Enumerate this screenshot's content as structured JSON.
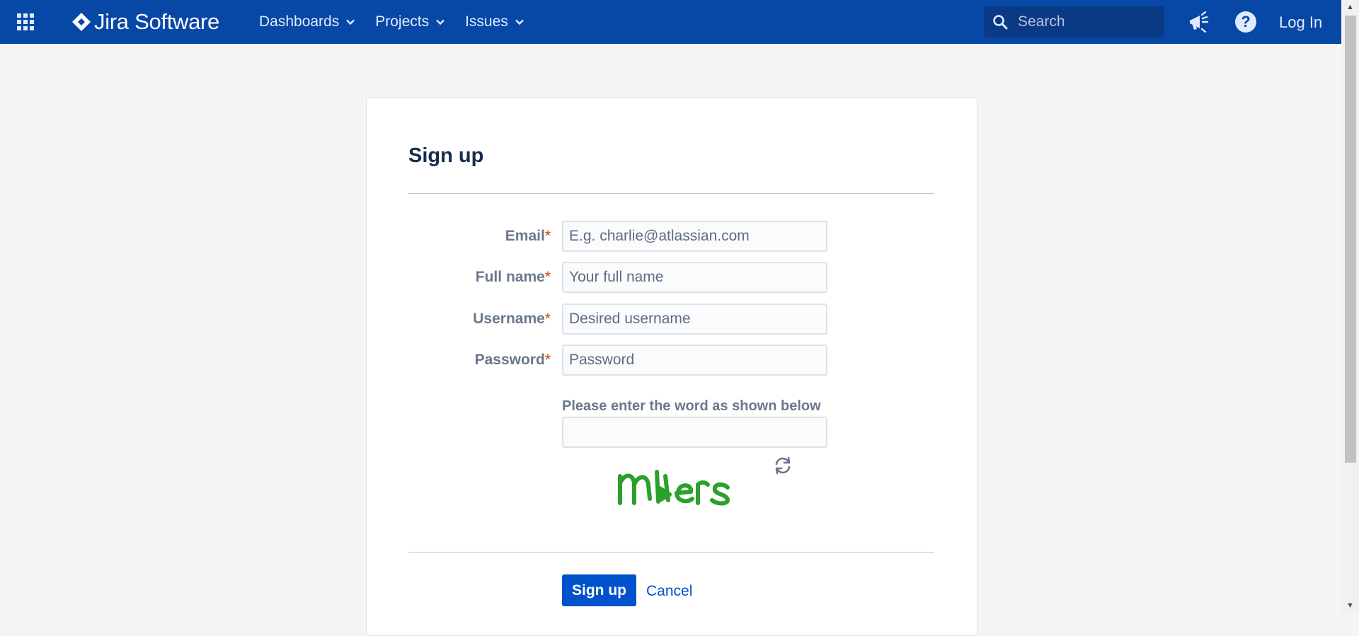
{
  "header": {
    "app_switcher_icon": "app-switcher-icon",
    "logo_text": "Jira Software",
    "nav": [
      {
        "label": "Dashboards"
      },
      {
        "label": "Projects"
      },
      {
        "label": "Issues"
      }
    ],
    "search_placeholder": "Search",
    "login_label": "Log In",
    "colors": {
      "bar": "#0747a6",
      "text": "#deebff"
    }
  },
  "signup": {
    "title": "Sign up",
    "fields": [
      {
        "label": "Email",
        "required_mark": "*",
        "placeholder": "E.g. charlie@atlassian.com"
      },
      {
        "label": "Full name",
        "required_mark": "*",
        "placeholder": "Your full name"
      },
      {
        "label": "Username",
        "required_mark": "*",
        "placeholder": "Desired username"
      },
      {
        "label": "Password",
        "required_mark": "*",
        "placeholder": "Password"
      }
    ],
    "captcha_label": "Please enter the word as shown below",
    "submit_label": "Sign up",
    "cancel_label": "Cancel",
    "colors": {
      "primary": "#0052cc",
      "required": "#de350b",
      "captcha": "#2ca02c"
    }
  }
}
